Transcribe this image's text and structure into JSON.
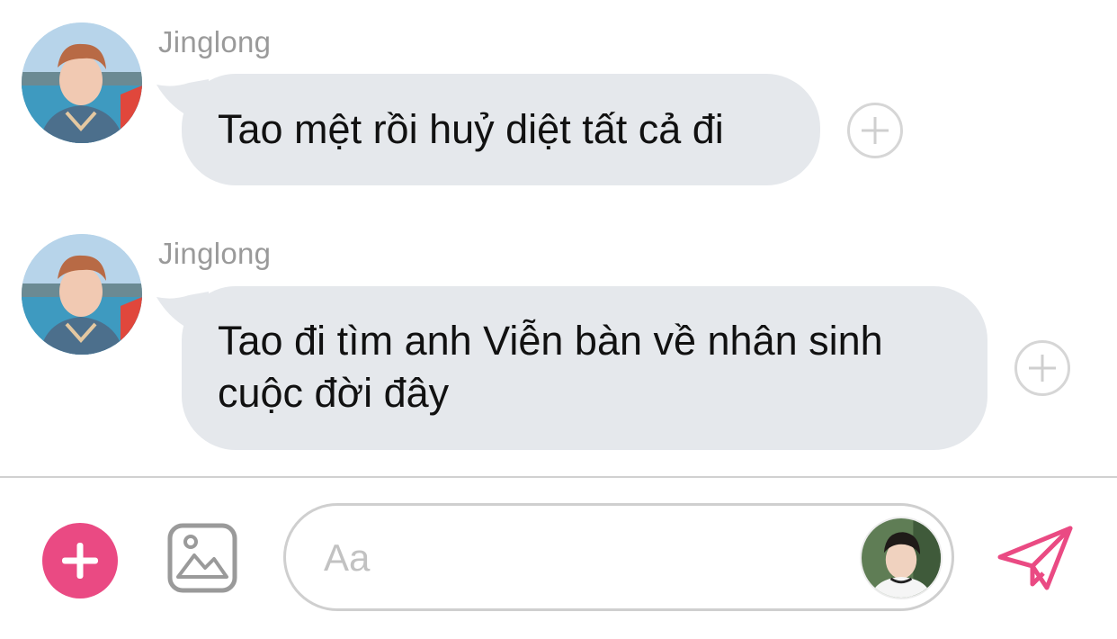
{
  "messages": [
    {
      "sender": "Jinglong",
      "text": "Tao mệt rồi huỷ diệt tất cả đi",
      "avatar_icon": "user-avatar-photo",
      "react_icon": "add-reaction-icon"
    },
    {
      "sender": "Jinglong",
      "text_line1": "Tao đi tìm anh Viễn bàn về nhân sinh",
      "text_line2": "cuộc đời đây",
      "avatar_icon": "user-avatar-photo",
      "react_icon": "add-reaction-icon"
    }
  ],
  "composer": {
    "placeholder": "Aa",
    "value": "",
    "plus_icon": "plus-icon",
    "image_icon": "image-icon",
    "send_icon": "send-icon",
    "self_avatar_icon": "self-avatar-photo"
  },
  "colors": {
    "accent": "#ea4a83",
    "bubble": "#e5e8ec",
    "sender_name": "#9a9a9a",
    "placeholder": "#c2c2c2"
  }
}
